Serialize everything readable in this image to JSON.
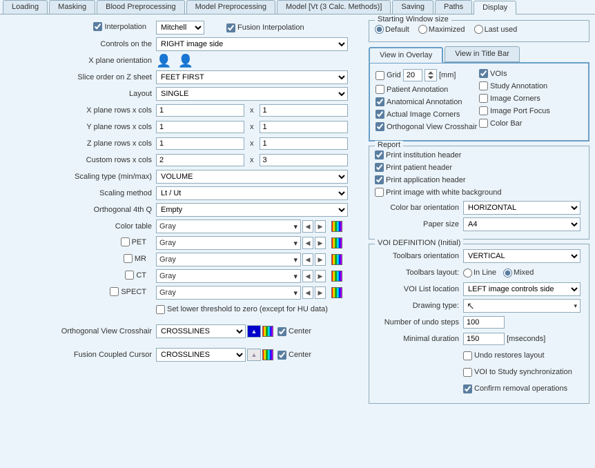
{
  "tabs": [
    "Loading",
    "Masking",
    "Blood Preprocessing",
    "Model Preprocessing",
    "Model  [Vt (3 Calc. Methods)]",
    "Saving",
    "Paths",
    "Display"
  ],
  "active_tab": 7,
  "top": {
    "interpolation_label": "Interpolation",
    "interpolation_value": "Mitchell",
    "fusion_interpolation_label": "Fusion Interpolation"
  },
  "rows": {
    "controls_on": {
      "label": "Controls on the",
      "value": "RIGHT image side"
    },
    "x_plane_orientation": {
      "label": "X plane orientation"
    },
    "slice_order": {
      "label": "Slice order on Z sheet",
      "value": "FEET FIRST"
    },
    "layout": {
      "label": "Layout",
      "value": "SINGLE"
    },
    "x_rowscols": {
      "label": "X plane rows x cols",
      "a": "1",
      "b": "1"
    },
    "y_rowscols": {
      "label": "Y plane rows x cols",
      "a": "1",
      "b": "1"
    },
    "z_rowscols": {
      "label": "Z plane rows x cols",
      "a": "1",
      "b": "1"
    },
    "custom_rowscols": {
      "label": "Custom rows x cols",
      "a": "2",
      "b": "3"
    },
    "scaling_type": {
      "label": "Scaling type (min/max)",
      "value": "VOLUME"
    },
    "scaling_method": {
      "label": "Scaling method",
      "value": "Lt / Ut"
    },
    "orthogonal_4q": {
      "label": "Orthogonal 4th Q",
      "value": "Empty"
    },
    "color_table": {
      "label": "Color table",
      "value": "Gray"
    },
    "pet": {
      "label": "PET",
      "value": "Gray"
    },
    "mr": {
      "label": "MR",
      "value": "Gray"
    },
    "ct": {
      "label": "CT",
      "value": "Gray"
    },
    "spect": {
      "label": "SPECT",
      "value": "Gray"
    },
    "lower_threshold": "Set lower threshold to zero (except for HU data)",
    "ortho_crosshair": {
      "label": "Orthogonal View Crosshair",
      "value": "CROSSLINES",
      "center": "Center"
    },
    "fusion_cursor": {
      "label": "Fusion Coupled Cursor",
      "value": "CROSSLINES",
      "center": "Center"
    }
  },
  "starting_window": {
    "title": "Starting Window size",
    "default": "Default",
    "maximized": "Maximized",
    "last_used": "Last used"
  },
  "subtabs": {
    "overlay": "View in Overlay",
    "titlebar": "View in Title Bar"
  },
  "overlay": {
    "grid": "Grid",
    "grid_value": "20",
    "mm": "[mm]",
    "vois": "VOIs",
    "patient_annotation": "Patient Annotation",
    "study_annotation": "Study Annotation",
    "anatomical_annotation": "Anatomical Annotation",
    "image_corners": "Image Corners",
    "actual_image_corners": "Actual Image Corners",
    "image_port_focus": "Image Port Focus",
    "ortho_crosshair": "Orthogonal View Crosshair",
    "color_bar": "Color Bar"
  },
  "report": {
    "title": "Report",
    "print_institution": "Print institution header",
    "print_patient": "Print patient header",
    "print_application": "Print application header",
    "print_white_bg": "Print image with white background",
    "color_bar_orientation": {
      "label": "Color bar orientation",
      "value": "HORIZONTAL"
    },
    "paper_size": {
      "label": "Paper size",
      "value": "A4"
    }
  },
  "voi": {
    "title": "VOI DEFINITION (Initial)",
    "toolbars_orientation": {
      "label": "Toolbars orientation",
      "value": "VERTICAL"
    },
    "toolbars_layout": {
      "label": "Toolbars layout:",
      "inline": "In Line",
      "mixed": "Mixed"
    },
    "voi_list_location": {
      "label": "VOI List location",
      "value": "LEFT image controls side"
    },
    "drawing_type": {
      "label": "Drawing type:",
      "value": ""
    },
    "undo_steps": {
      "label": "Number of undo steps",
      "value": "100"
    },
    "min_duration": {
      "label": "Minimal duration",
      "value": "150",
      "unit": "[mseconds]"
    },
    "undo_restores": "Undo restores layout",
    "voi_study_sync": "VOI to Study synchronization",
    "confirm_removal": "Confirm removal operations"
  }
}
